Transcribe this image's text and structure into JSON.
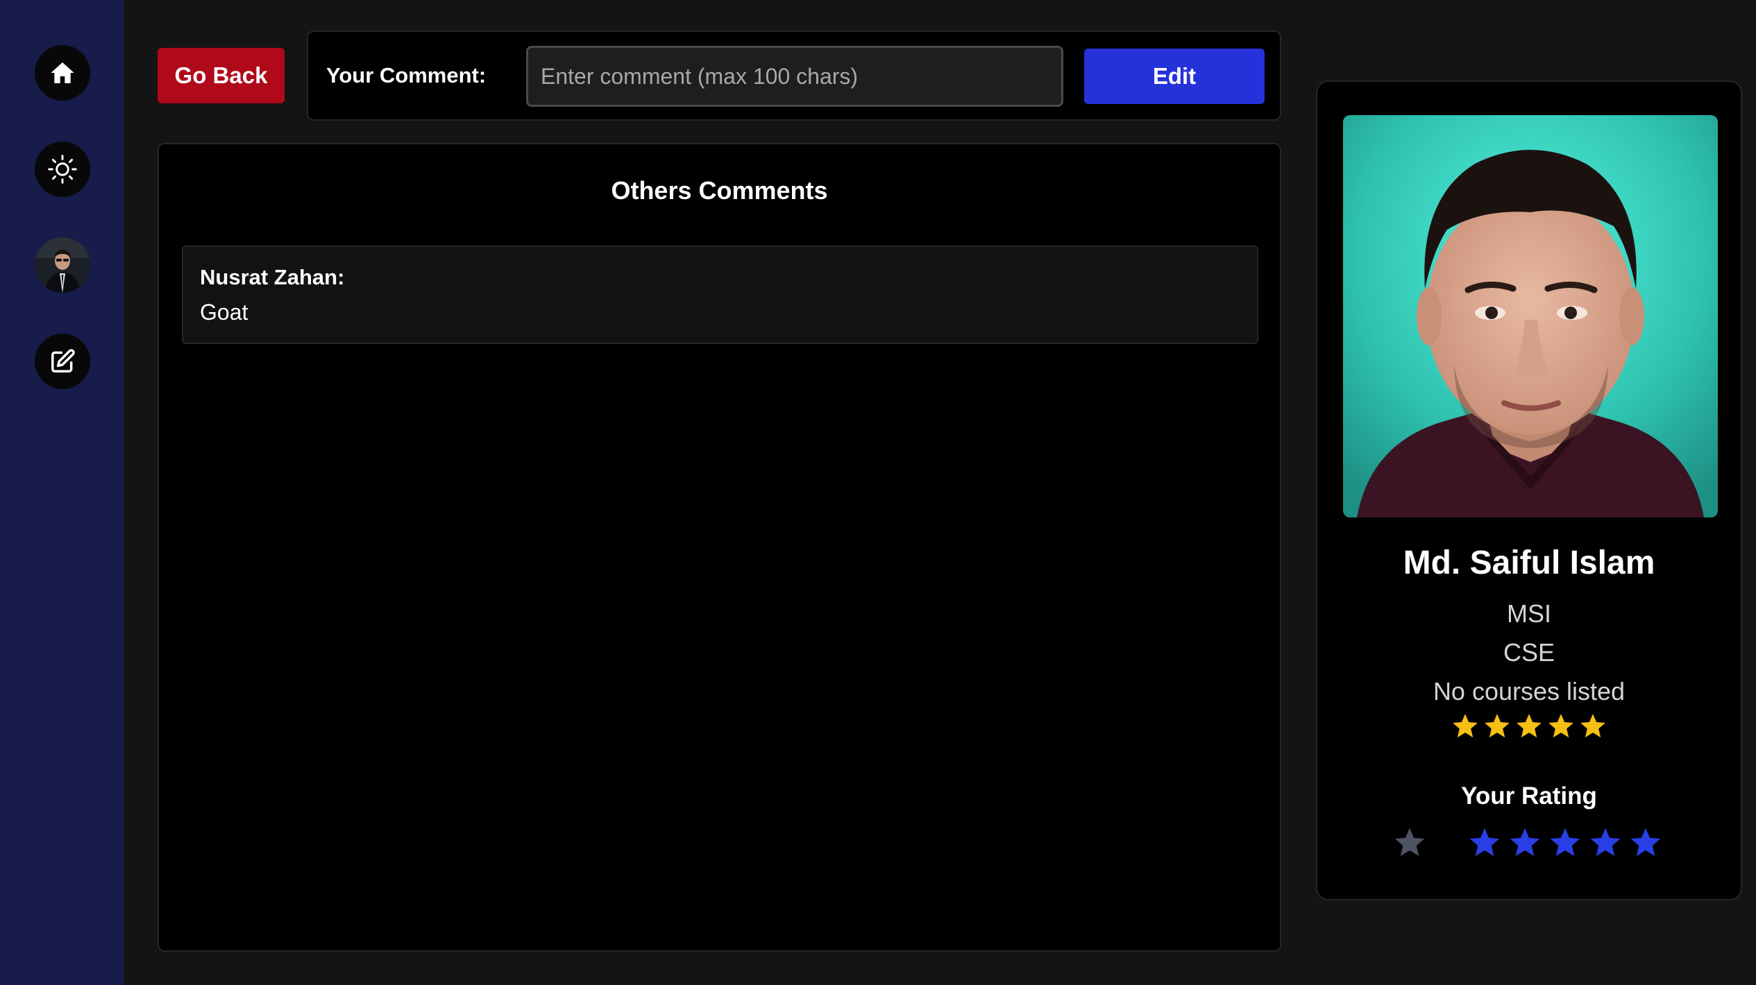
{
  "colors": {
    "sidebar": "#171c4a",
    "go_back": "#b0091a",
    "edit": "#2531d9",
    "star_gold": "#f5bf16",
    "star_blue": "#2a3ee5",
    "star_empty": "#4d5362"
  },
  "sidebar": {
    "items": [
      {
        "icon": "home-icon"
      },
      {
        "icon": "sun-icon"
      },
      {
        "icon": "avatar"
      },
      {
        "icon": "edit-square-icon"
      }
    ]
  },
  "header": {
    "go_back_label": "Go Back",
    "comment_label": "Your Comment:",
    "comment_placeholder": "Enter comment (max 100 chars)",
    "comment_value": "",
    "edit_label": "Edit"
  },
  "comments": {
    "title": "Others Comments",
    "items": [
      {
        "author": "Nusrat Zahan:",
        "text": "Goat"
      }
    ]
  },
  "profile": {
    "name": "Md. Saiful Islam",
    "initials": "MSI",
    "department": "CSE",
    "courses": "No courses listed",
    "average_rating": 5,
    "average_max": 5
  },
  "your_rating": {
    "title": "Your Rating",
    "stars": [
      {
        "state": "empty"
      },
      {
        "state": "filled"
      },
      {
        "state": "filled"
      },
      {
        "state": "filled"
      },
      {
        "state": "filled"
      },
      {
        "state": "filled"
      }
    ]
  }
}
